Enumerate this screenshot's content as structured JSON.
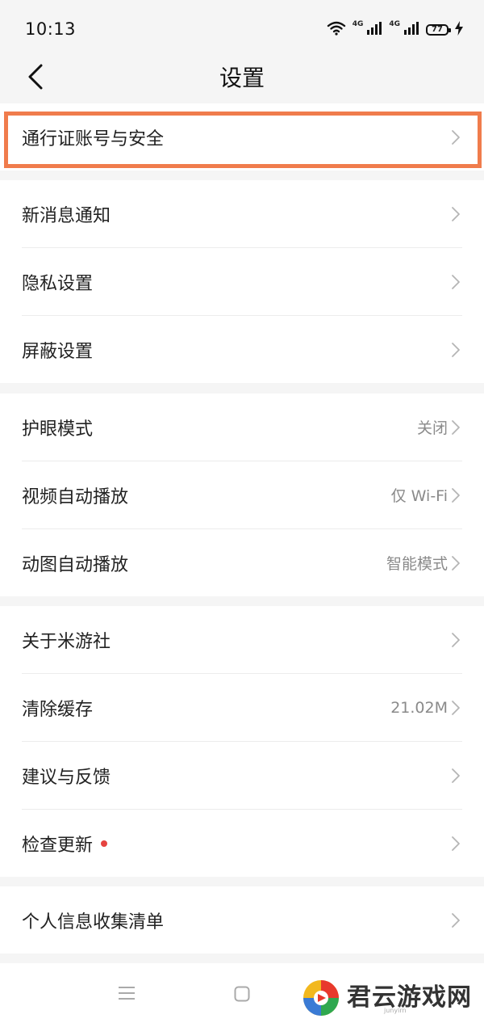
{
  "status_bar": {
    "time": "10:13",
    "signal_1_label": "4G",
    "signal_2_label": "4G",
    "battery_level": "77"
  },
  "header": {
    "title": "设置"
  },
  "groups": [
    {
      "items": [
        {
          "label": "通行证账号与安全",
          "value": ""
        }
      ]
    },
    {
      "items": [
        {
          "label": "新消息通知",
          "value": ""
        },
        {
          "label": "隐私设置",
          "value": ""
        },
        {
          "label": "屏蔽设置",
          "value": ""
        }
      ]
    },
    {
      "items": [
        {
          "label": "护眼模式",
          "value": "关闭"
        },
        {
          "label": "视频自动播放",
          "value": "仅 Wi-Fi"
        },
        {
          "label": "动图自动播放",
          "value": "智能模式"
        }
      ]
    },
    {
      "items": [
        {
          "label": "关于米游社",
          "value": ""
        },
        {
          "label": "清除缓存",
          "value": "21.02M"
        },
        {
          "label": "建议与反馈",
          "value": ""
        },
        {
          "label": "检查更新",
          "value": "",
          "badge": "red-dot"
        }
      ]
    },
    {
      "items": [
        {
          "label": "个人信息收集清单",
          "value": ""
        }
      ]
    }
  ],
  "watermark": {
    "text": "君云游戏网",
    "subtext": "junyirn"
  },
  "colors": {
    "highlight": "#f07c4c",
    "update_dot": "#e64340",
    "background": "#f5f5f5"
  }
}
